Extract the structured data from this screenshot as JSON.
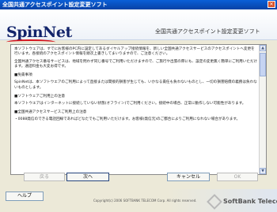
{
  "window": {
    "title": "全国共通アクセスポイント設定変更ソフト",
    "close_glyph": "✕"
  },
  "header": {
    "logo": "SpinNet",
    "title": "全国共通アクセスポイント設定変更ソフト"
  },
  "license": {
    "paragraphs": [
      "本ソフトウェアは、すでにお客様のPC内に設定してあるダイヤルアップ接続情報を、新しい全国共通アクセスサービスのアクセスポイントへ変更を行います。各接続のアクセスポイント情報を順次上書きしてまいりますので、ご注意ください。",
      "全国共通アクセス番号サービスは、地域を問わず同じ番号でご利用いただけますので、ご旅行や出張の際にも、設定の変更無く簡単にご利用いただけます。通話料金も大変お得です。",
      "■免責事項",
      "SpinNetは、本ソフトウエアのご利用によって直接または間接的損害が生じても、いかなる責任も負わないものとし、一切の損害賠償の義務は負わないものとします。",
      "■ソフトウェアご利用上の注意",
      "本ソフトウエアはインターネットに接続していない状態(オフライン)でご利用ください。接続中の場合、正常に動作しない可能性があります。",
      "■全国共通アクセスサービスご利用上の注意",
      "・0088発信のできる電話回線であればどなたでもご利用いただけます。お客様(発信元)のご都合によりご利用になれない場合があります。"
    ],
    "scroll_up": "▲",
    "scroll_down": "▼"
  },
  "buttons": {
    "back": "戻る",
    "next": "次へ",
    "cancel": "キャンセル",
    "ok": "OK",
    "help": "ヘルプ"
  },
  "footer": {
    "copyright": "Copyright(c) 2006 SOFTBANK TELECOM Corp. All rights reserved.",
    "brand": "SoftBank Telecom"
  }
}
